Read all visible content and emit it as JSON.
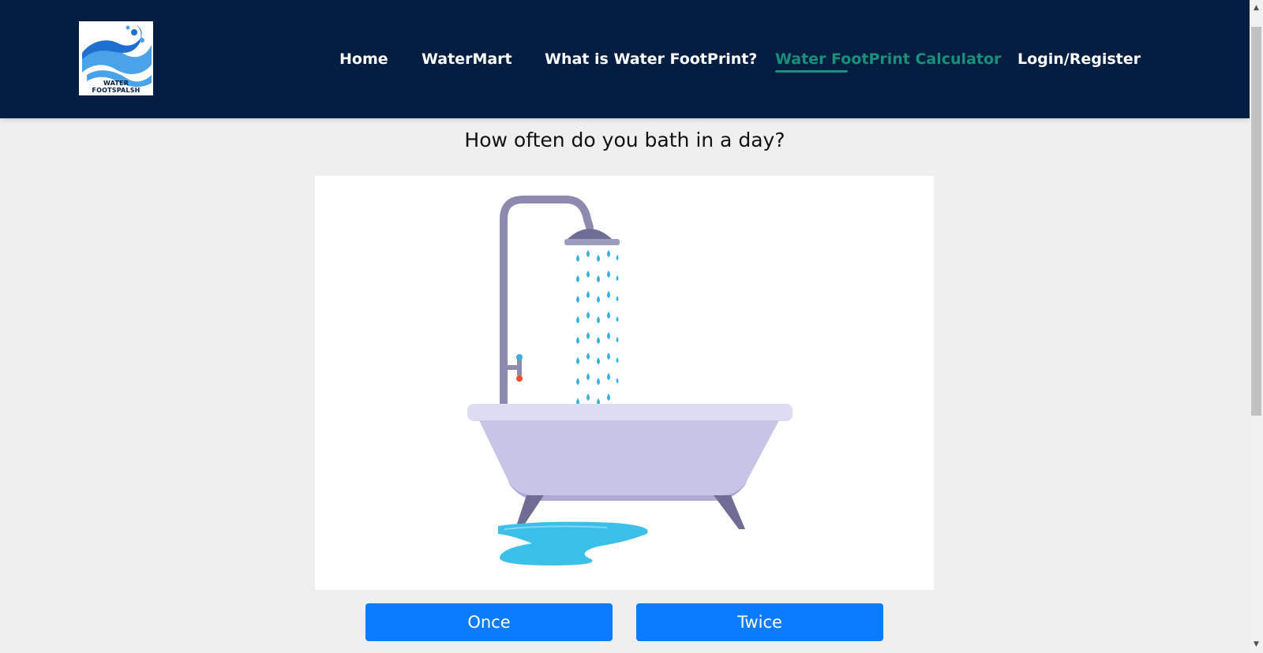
{
  "header": {
    "logo_text": "WATER FOOTSPALSH",
    "nav": [
      {
        "label": "Home"
      },
      {
        "label": "WaterMart"
      },
      {
        "label": "What is Water FootPrint?"
      },
      {
        "label": "Water FootPrint Calculator",
        "active": true
      },
      {
        "label": "Login/Register"
      }
    ]
  },
  "main": {
    "question": "How often do you bath in a day?",
    "illustration_icon": "bathtub-shower-icon",
    "answers": [
      {
        "label": "Once"
      },
      {
        "label": "Twice"
      }
    ]
  },
  "colors": {
    "header_bg": "#041e42",
    "active_nav": "#1a8f7a",
    "button_bg": "#0a7cff",
    "page_bg": "#efefef"
  }
}
